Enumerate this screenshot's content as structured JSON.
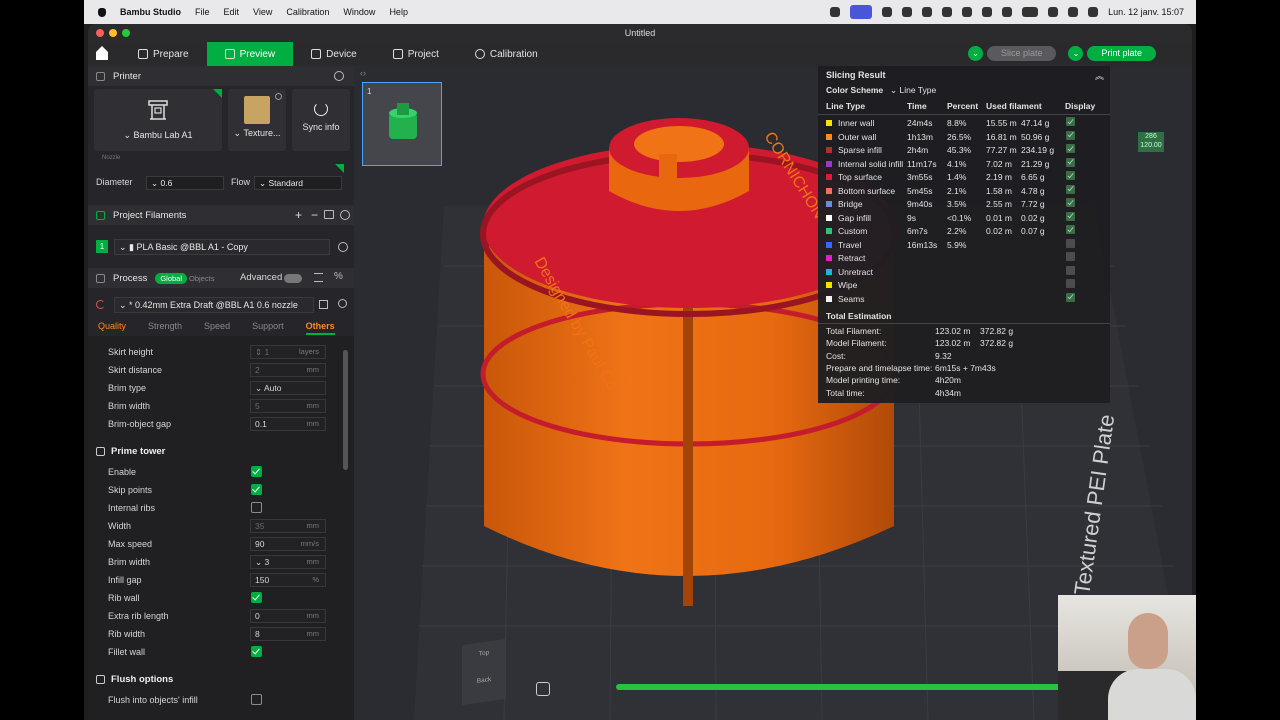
{
  "menubar": {
    "app": "Bambu Studio",
    "items": [
      "File",
      "Edit",
      "View",
      "Calibration",
      "Window",
      "Help"
    ],
    "clock": "Lun. 12 janv.  15:07"
  },
  "window": {
    "title": "Untitled"
  },
  "toolbar": {
    "tabs": [
      "Prepare",
      "Preview",
      "Device",
      "Project",
      "Calibration"
    ],
    "slice_label": "Slice plate",
    "print_label": "Print plate"
  },
  "printer": {
    "section": "Printer",
    "name": "Bambu Lab A1",
    "plate": "Texture...",
    "sync": "Sync info",
    "nozzle_label": "Nozzle",
    "diameter_label": "Diameter",
    "diameter": "0.6",
    "flow_label": "Flow",
    "flow": "Standard"
  },
  "filaments": {
    "section": "Project Filaments",
    "index": "1",
    "name": "PLA Basic @BBL A1 - Copy"
  },
  "process": {
    "section": "Process",
    "global": "Global",
    "objects": "Objects",
    "advanced": "Advanced",
    "preset": "* 0.42mm Extra Draft @BBL A1 0.6 nozzle",
    "tabs": [
      "Quality",
      "Strength",
      "Speed",
      "Support",
      "Others"
    ]
  },
  "options": {
    "skirt_height": {
      "label": "Skirt height",
      "value": "1",
      "unit": "layers"
    },
    "skirt_distance": {
      "label": "Skirt distance",
      "value": "2",
      "unit": "mm"
    },
    "brim_type": {
      "label": "Brim type",
      "value": "Auto"
    },
    "brim_width": {
      "label": "Brim width",
      "value": "5",
      "unit": "mm"
    },
    "brim_object_gap": {
      "label": "Brim-object gap",
      "value": "0.1",
      "unit": "mm"
    },
    "prime_tower_title": "Prime tower",
    "enable": "Enable",
    "skip_points": "Skip points",
    "internal_ribs": "Internal ribs",
    "width": {
      "label": "Width",
      "value": "35",
      "unit": "mm"
    },
    "max_speed": {
      "label": "Max speed",
      "value": "90",
      "unit": "mm/s"
    },
    "pt_brim_width": {
      "label": "Brim width",
      "value": "3",
      "unit": "mm"
    },
    "infill_gap": {
      "label": "Infill gap",
      "value": "150",
      "unit": "%"
    },
    "rib_wall": "Rib wall",
    "extra_rib_length": {
      "label": "Extra rib length",
      "value": "0",
      "unit": "mm"
    },
    "rib_width": {
      "label": "Rib width",
      "value": "8",
      "unit": "mm"
    },
    "fillet_wall": "Fillet wall",
    "flush_title": "Flush options",
    "flush_infill": "Flush into objects' infill"
  },
  "viewport": {
    "plate_number": "1",
    "plate_label": "Textured PEI Plate",
    "layer_top": "286",
    "layer_height": "120.00",
    "model_text": "Designed by Paul Co... CORNICHON 2025",
    "nav_top": "Top",
    "nav_back": "Back"
  },
  "result": {
    "title": "Slicing Result",
    "color_scheme": "Color Scheme",
    "scheme": "Line Type",
    "headers": [
      "Line Type",
      "Time",
      "Percent",
      "Used filament",
      "Display"
    ],
    "rows": [
      {
        "name": "Inner wall",
        "color": "#f3e600",
        "time": "24m4s",
        "percent": "8.8%",
        "len": "15.55 m",
        "weight": "47.14 g",
        "display": true
      },
      {
        "name": "Outer wall",
        "color": "#ff8a1f",
        "time": "1h13m",
        "percent": "26.5%",
        "len": "16.81 m",
        "weight": "50.96 g",
        "display": true
      },
      {
        "name": "Sparse infill",
        "color": "#b32e2e",
        "time": "2h4m",
        "percent": "45.3%",
        "len": "77.27 m",
        "weight": "234.19 g",
        "display": true
      },
      {
        "name": "Internal solid infill",
        "color": "#9a38c8",
        "time": "11m17s",
        "percent": "4.1%",
        "len": "7.02 m",
        "weight": "21.29 g",
        "display": true
      },
      {
        "name": "Top surface",
        "color": "#e0183a",
        "time": "3m55s",
        "percent": "1.4%",
        "len": "2.19 m",
        "weight": "6.65 g",
        "display": true
      },
      {
        "name": "Bottom surface",
        "color": "#f07060",
        "time": "5m45s",
        "percent": "2.1%",
        "len": "1.58 m",
        "weight": "4.78 g",
        "display": true
      },
      {
        "name": "Bridge",
        "color": "#6f8bd6",
        "time": "9m40s",
        "percent": "3.5%",
        "len": "2.55 m",
        "weight": "7.72 g",
        "display": true
      },
      {
        "name": "Gap infill",
        "color": "#ffffff",
        "time": "9s",
        "percent": "<0.1%",
        "len": "0.01 m",
        "weight": "0.02 g",
        "display": true
      },
      {
        "name": "Custom",
        "color": "#2ec27a",
        "time": "6m7s",
        "percent": "2.2%",
        "len": "0.02 m",
        "weight": "0.07 g",
        "display": true
      },
      {
        "name": "Travel",
        "color": "#2b6ef5",
        "time": "16m13s",
        "percent": "5.9%",
        "len": "",
        "weight": "",
        "display": false
      },
      {
        "name": "Retract",
        "color": "#e020c8",
        "time": "",
        "percent": "",
        "len": "",
        "weight": "",
        "display": false
      },
      {
        "name": "Unretract",
        "color": "#18b8d8",
        "time": "",
        "percent": "",
        "len": "",
        "weight": "",
        "display": false
      },
      {
        "name": "Wipe",
        "color": "#f5e000",
        "time": "",
        "percent": "",
        "len": "",
        "weight": "",
        "display": false
      },
      {
        "name": "Seams",
        "color": "#f2f2f2",
        "time": "",
        "percent": "",
        "len": "",
        "weight": "",
        "display": true
      }
    ],
    "total_title": "Total Estimation",
    "totals": [
      {
        "label": "Total Filament:",
        "a": "123.02 m",
        "b": "372.82 g"
      },
      {
        "label": "Model Filament:",
        "a": "123.02 m",
        "b": "372.82 g"
      },
      {
        "label": "Cost:",
        "a": "9.32",
        "b": ""
      },
      {
        "label": "Prepare and timelapse time:",
        "a": "6m15s + 7m43s",
        "b": ""
      },
      {
        "label": "Model printing time:",
        "a": "4h20m",
        "b": ""
      },
      {
        "label": "Total time:",
        "a": "4h34m",
        "b": ""
      }
    ]
  }
}
